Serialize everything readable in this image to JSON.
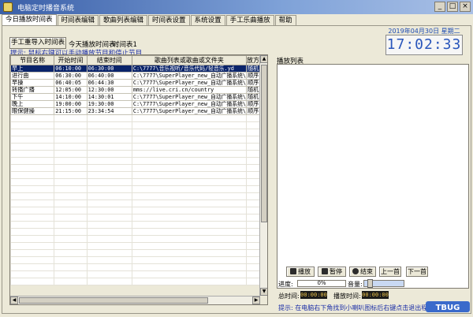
{
  "window": {
    "title": "电脑定时播音系统",
    "controls": {
      "minimize": "_",
      "maximize": "□",
      "close": "×"
    }
  },
  "tabs": [
    "今日播放时间表",
    "时间表编辑",
    "歌曲列表编辑",
    "时间表设置",
    "系统设置",
    "手工乐曲播放",
    "帮助"
  ],
  "active_tab": 0,
  "toolbar": {
    "import_button": "手工重导入时间表",
    "today_count_label": "今天播放时间表:",
    "today_count_value": "时间表1",
    "hint": "提示: 鼠标右键可以手动播放节目和停止节目"
  },
  "clock": {
    "date": "2019年04月30日 星期二",
    "time": "17:02:33"
  },
  "schedule_table": {
    "columns": [
      "节目名称",
      "开始时间",
      "结束时间",
      "歌曲列表或歌曲或文件夹",
      "放方"
    ],
    "rows": [
      [
        "早上",
        "06:10:00",
        "06:30:00",
        "C:\\7777\\音乐视听/音乐代码/轻音乐.yd",
        "随机"
      ],
      [
        "进行曲",
        "06:30:00",
        "06:40:00",
        "C:\\7777\\SuperPlayer_new_自动广播系统\\",
        "顺序"
      ],
      [
        "早操",
        "06:40:05",
        "06:44:30",
        "C:\\7777\\SuperPlayer_new_自动广播系统\\",
        "顺序"
      ],
      [
        "转播广播",
        "12:05:00",
        "12:30:00",
        "mms://live.cri.cn/country",
        "随机"
      ],
      [
        "下午",
        "14:10:00",
        "14:30:01",
        "C:\\7777\\SuperPlayer_new_自动广播系统\\",
        "随机"
      ],
      [
        "晚上",
        "19:00:00",
        "19:30:00",
        "C:\\7777\\SuperPlayer_new_自动广播系统\\",
        "顺序"
      ],
      [
        "眼保健操",
        "21:15:00",
        "23:34:54",
        "C:\\7777\\SuperPlayer_new_自动广播系统\\",
        "顺序"
      ]
    ],
    "selected_row": 0
  },
  "playlist": {
    "label": "播放列表"
  },
  "player": {
    "play": "播放",
    "pause": "暂停",
    "stop": "结束",
    "prev": "上一首",
    "next": "下一首",
    "progress_label": "进度:",
    "progress_value": "0%",
    "progress_fraction": 0,
    "volume_label": "音量:",
    "volume_fraction": 0.1,
    "total_time_label": "总时间:",
    "total_time_value": "00:00:00",
    "played_time_label": "播放时间:",
    "played_time_value": "00:00:00",
    "status_hint": "提示: 在电脑右下角找到小喇叭图标后右键点击退出程序"
  },
  "watermark": {
    "text": "TBUG"
  },
  "colors": {
    "titlebar": "#3a5fa8",
    "hint_text": "#1a2da6",
    "clock_text": "#2a56bb",
    "selected_row": "#0a246a"
  }
}
